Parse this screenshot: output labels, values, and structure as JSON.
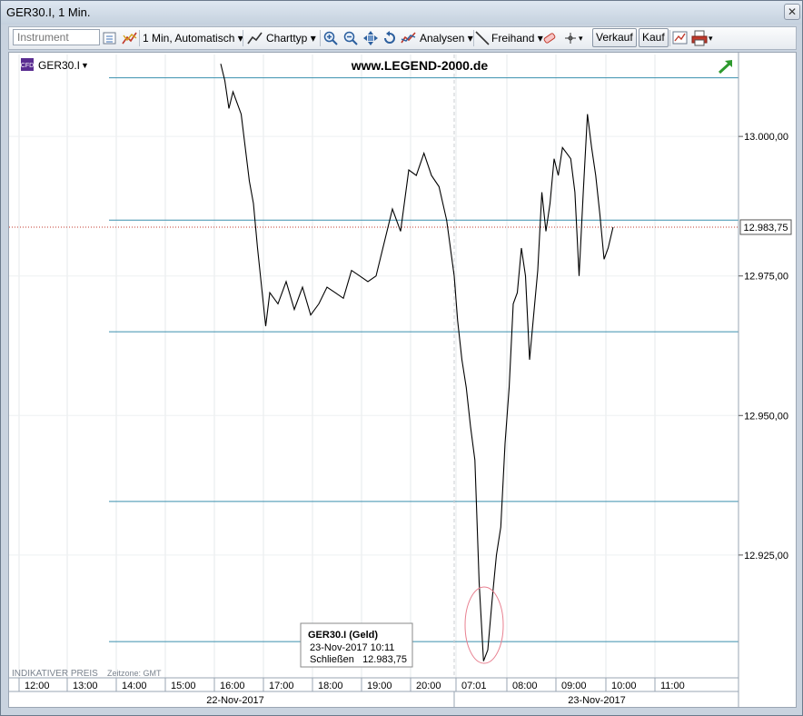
{
  "window": {
    "title": "GER30.I, 1 Min.",
    "close_label": "✕"
  },
  "toolbar": {
    "instrument_placeholder": "Instrument",
    "interval_label": "1 Min,  Automatisch",
    "charttype_label": "Charttyp",
    "analysen_label": "Analysen",
    "freihand_label": "Freihand",
    "sell_label": "Verkauf",
    "buy_label": "Kauf"
  },
  "chart_header": {
    "symbol": "GER30.I",
    "watermark": "www.LEGEND-2000.de",
    "badge": "CFD"
  },
  "footer": {
    "indicative": "INDIKATIVER PREIS",
    "timezone": "Zeitzone: GMT"
  },
  "tooltip": {
    "title": "GER30.I (Geld)",
    "datetime": "23-Nov-2017 10:11",
    "close_label": "Schließen",
    "close_value": "12.983,75"
  },
  "chart_data": {
    "type": "line",
    "title": "GER30.I, 1 Min.",
    "xlabel": "",
    "ylabel": "",
    "ylim": [
      12903,
      13015
    ],
    "y_ticks": [
      "13.000,00",
      "12.975,00",
      "12.950,00",
      "12.925,00"
    ],
    "y_tick_values": [
      13000,
      12975,
      12950,
      12925
    ],
    "x_ticks": [
      "12:00",
      "13:00",
      "14:00",
      "15:00",
      "16:00",
      "17:00",
      "18:00",
      "19:00",
      "20:00",
      "07:01",
      "08:00",
      "09:00",
      "10:00",
      "11:00"
    ],
    "dates": [
      "22-Nov-2017",
      "23-Nov-2017"
    ],
    "current_price_label": "12.983,75",
    "current_price": 12983.75,
    "horizontal_levels": [
      13010.5,
      12985,
      12965,
      12934.6,
      12909.5
    ],
    "series": [
      {
        "color": "#000000",
        "x": [
          "16:10",
          "16:15",
          "16:20",
          "16:25",
          "16:30",
          "16:35",
          "16:40",
          "16:45",
          "16:50",
          "16:55",
          "17:00",
          "17:05",
          "17:10",
          "17:20",
          "17:30",
          "17:40",
          "17:50",
          "18:00",
          "18:10",
          "18:20",
          "18:30",
          "18:40",
          "18:50",
          "19:00",
          "19:10",
          "19:20",
          "19:30",
          "19:40",
          "19:50",
          "20:00",
          "20:10",
          "20:20",
          "20:30",
          "20:40",
          "20:50",
          "07:01",
          "07:05",
          "07:10",
          "07:15",
          "07:20",
          "07:25",
          "07:30",
          "07:35",
          "07:40",
          "07:45",
          "07:50",
          "07:55",
          "08:00",
          "08:05",
          "08:10",
          "08:15",
          "08:20",
          "08:25",
          "08:30",
          "08:35",
          "08:40",
          "08:45",
          "08:50",
          "08:55",
          "09:00",
          "09:05",
          "09:10",
          "09:15",
          "09:20",
          "09:25",
          "09:30",
          "09:35",
          "09:40",
          "09:45",
          "09:50",
          "09:55",
          "10:00",
          "10:05",
          "10:11"
        ],
        "values": [
          13013,
          13010,
          13005,
          13008,
          13006,
          13004,
          12998,
          12992,
          12988,
          12980,
          12973,
          12966,
          12972,
          12970,
          12974,
          12969,
          12973,
          12968,
          12970,
          12973,
          12972,
          12971,
          12976,
          12975,
          12974,
          12975,
          12981,
          12987,
          12983,
          12994,
          12993,
          12997,
          12993,
          12991,
          12985,
          12975,
          12967,
          12960,
          12955,
          12948,
          12942,
          12920,
          12906,
          12908,
          12917,
          12925,
          12930,
          12945,
          12955,
          12970,
          12972,
          12980,
          12975,
          12960,
          12968,
          12976,
          12990,
          12983,
          12988,
          12996,
          12993,
          12998,
          12997,
          12996,
          12990,
          12975,
          12990,
          13004,
          12998,
          12993,
          12986,
          12978,
          12980,
          12983.75
        ]
      }
    ]
  }
}
